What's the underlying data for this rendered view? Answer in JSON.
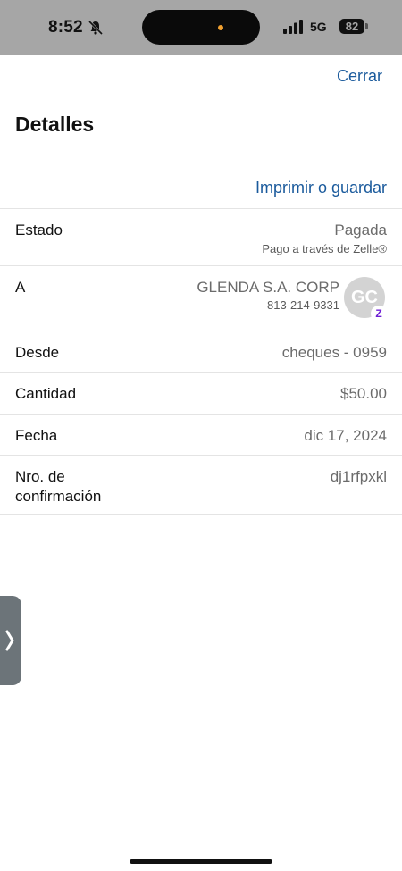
{
  "status_bar": {
    "time": "8:52",
    "network": "5G",
    "battery": "82",
    "icons": [
      "bell-slash-icon",
      "signal-icon",
      "battery-icon"
    ]
  },
  "header": {
    "close_label": "Cerrar",
    "title": "Detalles",
    "print_label": "Imprimir o guardar"
  },
  "details": {
    "status": {
      "label": "Estado",
      "value": "Pagada",
      "sub": "Pago a través de Zelle®"
    },
    "to": {
      "label": "A",
      "name": "GLENDA S.A. CORP",
      "phone": "813-214-9331",
      "initials": "GC",
      "badge": "Z"
    },
    "from": {
      "label": "Desde",
      "value": "cheques - 0959"
    },
    "amount": {
      "label": "Cantidad",
      "value": "$50.00"
    },
    "date": {
      "label": "Fecha",
      "value": "dic 17, 2024"
    },
    "confirmation": {
      "label_line1": "Nro. de",
      "label_line2": "confirmación",
      "value": "dj1rfpxkl"
    }
  },
  "colors": {
    "link": "#1a5a9c",
    "status_bar_bg": "#a6a6a6",
    "zelle": "#6d1ed4"
  }
}
